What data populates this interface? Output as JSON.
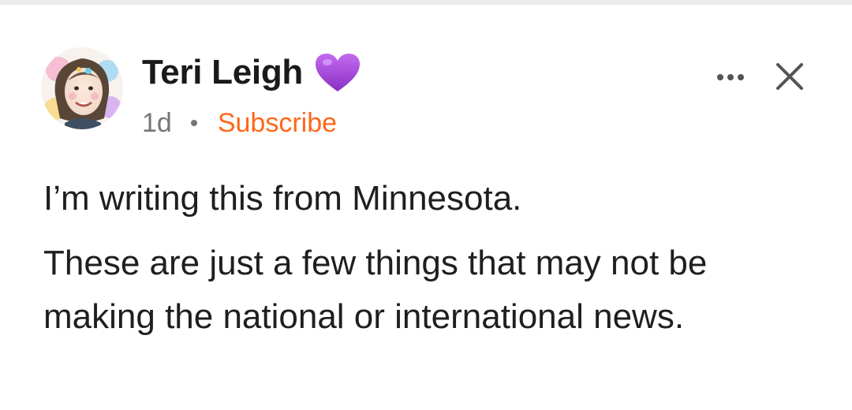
{
  "post": {
    "author": {
      "name": "Teri Leigh",
      "badge_icon": "purple-heart-icon",
      "avatar_icon": "author-avatar"
    },
    "meta": {
      "time": "1d",
      "subscribe_label": "Subscribe"
    },
    "actions": {
      "more_icon": "more-options-icon",
      "close_icon": "close-icon"
    },
    "paragraphs": [
      "I’m writing this from Minnesota.",
      "These are just a few things that may not be making the national or international news."
    ]
  },
  "colors": {
    "accent": "#ff6719",
    "heart": "#a33fd8",
    "muted": "#767676",
    "text": "#1f1f1f"
  }
}
